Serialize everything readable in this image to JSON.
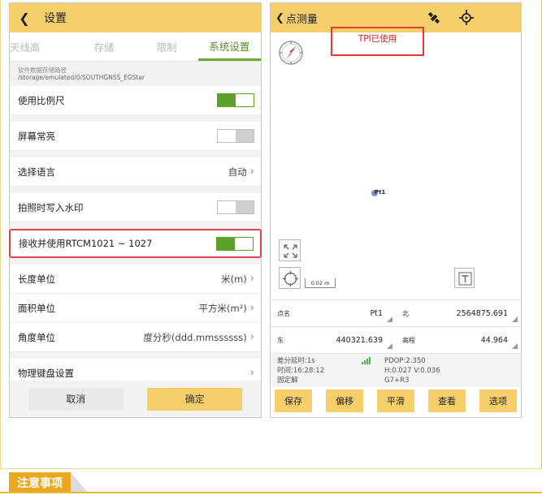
{
  "left": {
    "header": {
      "title": "设置"
    },
    "tabs": [
      "天线高",
      "存储",
      "限制",
      "系统设置"
    ],
    "storage_path": {
      "label": "软件数据存储路径",
      "value": "/storage/emulated/0/SOUTHGNSS_EGStar"
    },
    "rows": {
      "scale": {
        "label": "使用比例尺",
        "toggle": "on"
      },
      "screen_on": {
        "label": "屏幕常亮",
        "toggle": "off"
      },
      "language": {
        "label": "选择语言",
        "value": "自动"
      },
      "watermark": {
        "label": "拍照时写入水印",
        "toggle": "off"
      },
      "rtcm": {
        "label": "接收并使用RTCM1021 ~ 1027",
        "toggle": "on"
      },
      "length_unit": {
        "label": "长度单位",
        "value": "米(m)"
      },
      "area_unit": {
        "label": "面积单位",
        "value": "平方米(m²)"
      },
      "angle_unit": {
        "label": "角度单位",
        "value": "度分秒(ddd.mmssssss)"
      },
      "keyboard": {
        "label": "物理键盘设置"
      }
    },
    "buttons": {
      "cancel": "取消",
      "ok": "确定"
    }
  },
  "right": {
    "header": {
      "title": "点测量"
    },
    "tpi_notice": "TPI已使用",
    "point_label": "Pt1",
    "scale_label": "0.02 m",
    "fields": {
      "name": {
        "key": "点名",
        "value": "Pt1"
      },
      "north": {
        "key": "北",
        "value": "2564875.691"
      },
      "east": {
        "key": "东",
        "value": "440321.639"
      },
      "elev": {
        "key": "高程",
        "value": "44.964"
      }
    },
    "status": {
      "delay": "差分延时:1s",
      "time": "时间:16:28:12",
      "solution": "固定解",
      "pdop": "PDOP:2.350",
      "hv": "H:0.027  V:0.036",
      "sats": "G7+R3"
    },
    "buttons": [
      "保存",
      "偏移",
      "平滑",
      "查看",
      "选项"
    ]
  },
  "note": {
    "title": "注意事项"
  },
  "colors": {
    "accent": "#f6cf6b",
    "toggle_on": "#5ea12a",
    "highlight": "#e04545",
    "note": "#e8a820"
  }
}
